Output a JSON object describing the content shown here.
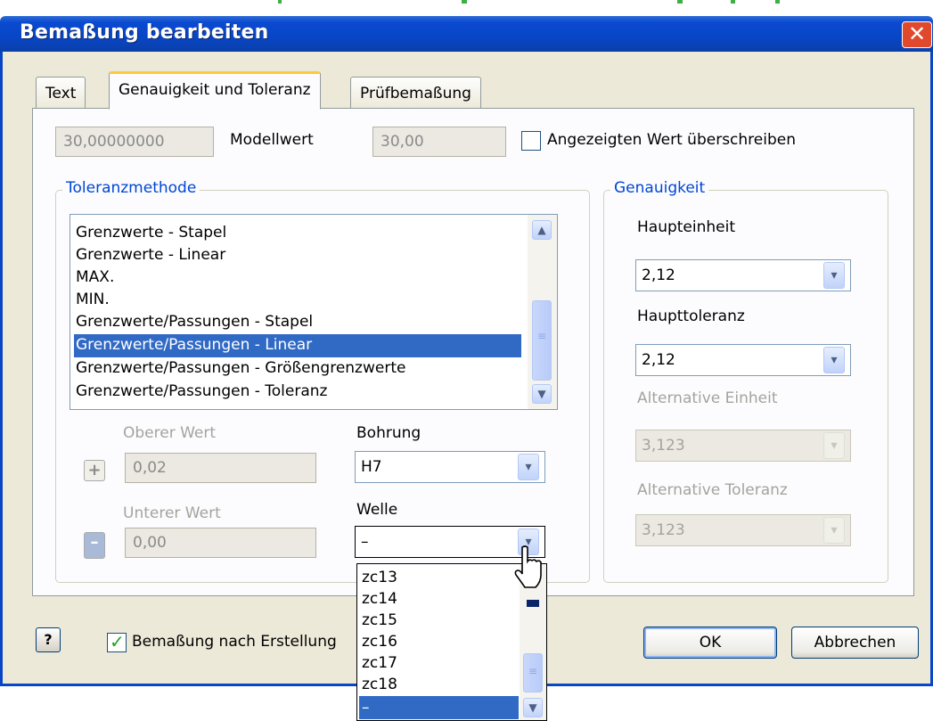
{
  "window": {
    "title": "Bemaßung bearbeiten",
    "close_glyph": "✕"
  },
  "tabs": [
    {
      "label": "Text"
    },
    {
      "label": "Genauigkeit und Toleranz"
    },
    {
      "label": "Prüfbemaßung"
    }
  ],
  "model_value": {
    "value_field": "30,00000000",
    "label": "Modellwert",
    "display_field": "30,00",
    "override_label": "Angezeigten Wert überschreiben",
    "override_checked": false
  },
  "tolerance_method": {
    "title": "Toleranzmethode",
    "items": [
      "Grenzwerte - Stapel",
      "Grenzwerte - Linear",
      "MAX.",
      "MIN.",
      "Grenzwerte/Passungen - Stapel",
      "Grenzwerte/Passungen - Linear",
      "Grenzwerte/Passungen - Größengrenzwerte",
      "Grenzwerte/Passungen - Toleranz"
    ],
    "selected": "Grenzwerte/Passungen - Linear"
  },
  "limits": {
    "upper_label": "Oberer Wert",
    "upper_value": "0,02",
    "plus_glyph": "+",
    "lower_label": "Unterer Wert",
    "lower_value": "0,00",
    "minus_glyph": "–",
    "bore_label": "Bohrung",
    "bore_value": "H7",
    "shaft_label": "Welle",
    "shaft_value": "–"
  },
  "shaft_dropdown": {
    "options": [
      "zc13",
      "zc14",
      "zc15",
      "zc16",
      "zc17",
      "zc18",
      "–"
    ],
    "selected": "–"
  },
  "precision": {
    "title": "Genauigkeit",
    "primary_unit_label": "Haupteinheit",
    "primary_unit_value": "2,12",
    "primary_tol_label": "Haupttoleranz",
    "primary_tol_value": "2,12",
    "alt_unit_label": "Alternative Einheit",
    "alt_unit_value": "3,123",
    "alt_tol_label": "Alternative Toleranz",
    "alt_tol_value": "3,123"
  },
  "footer": {
    "help_glyph": "?",
    "edit_after_create_label": "Bemaßung nach Erstellung",
    "edit_after_create_checked": true,
    "ok_label": "OK",
    "cancel_label": "Abbrechen"
  },
  "icons": {
    "dropdown_arrow": "▾",
    "scroll_up": "▲",
    "scroll_down": "▼",
    "thumb_grip": "≡"
  },
  "colors": {
    "titlebar": "#0846c6",
    "selection": "#316ac5",
    "group_title": "#0046d5",
    "dialog_bg": "#ece9d8"
  }
}
